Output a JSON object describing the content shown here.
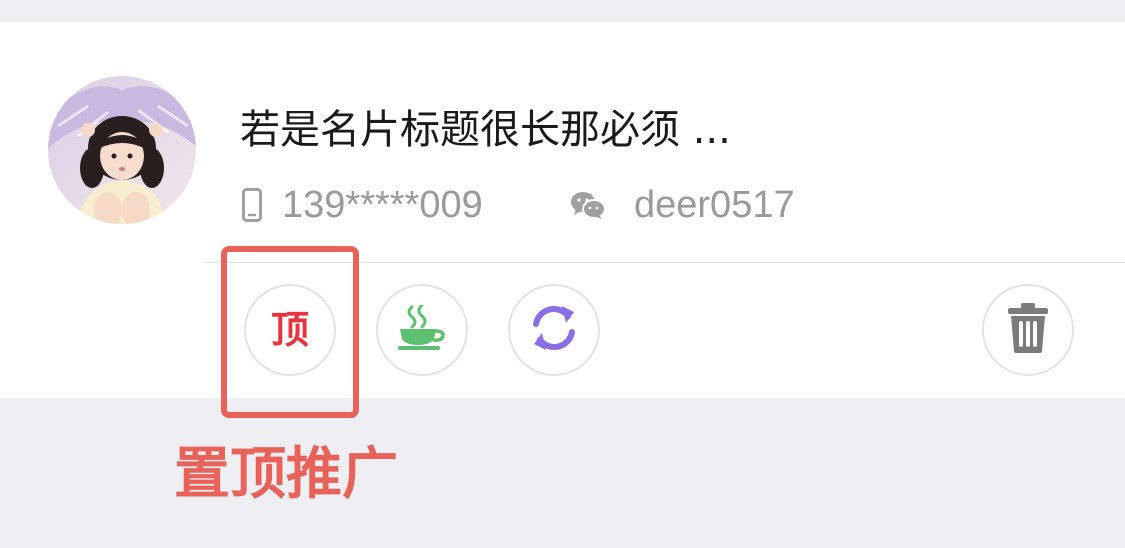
{
  "card": {
    "avatar_icon": "avatar-photo",
    "title": "若是名片标题很长那必须 ...",
    "phone": {
      "icon": "mobile-phone-icon",
      "value": "139*****009"
    },
    "wechat": {
      "icon": "wechat-icon",
      "value": "deer0517"
    }
  },
  "actions": {
    "pin_top": {
      "icon": "top-icon",
      "glyph": "顶",
      "color": "#e8343e"
    },
    "tea": {
      "icon": "tea-cup-icon",
      "color": "#5cc070"
    },
    "refresh": {
      "icon": "refresh-icon",
      "color": "#8a6ee6"
    },
    "delete": {
      "icon": "trash-icon",
      "color": "#7b7b7b"
    }
  },
  "annotation": {
    "text": "置顶推广",
    "color": "#e8625a"
  }
}
